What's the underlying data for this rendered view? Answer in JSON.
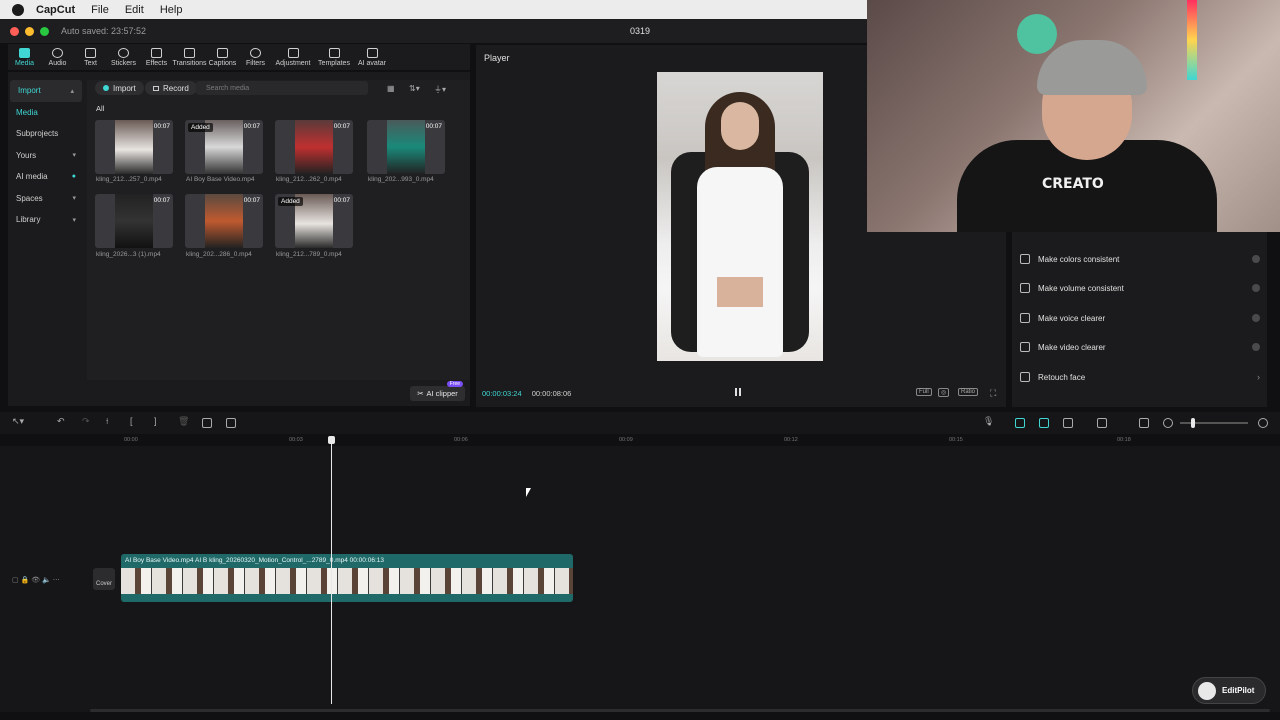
{
  "menubar": {
    "app": "CapCut",
    "items": [
      "File",
      "Edit",
      "Help"
    ]
  },
  "window": {
    "autosave": "Auto saved: 23:57:52",
    "project": "0319"
  },
  "toolbar": {
    "tools": [
      "Media",
      "Audio",
      "Text",
      "Stickers",
      "Effects",
      "Transitions",
      "Captions",
      "Filters",
      "Adjustment",
      "Templates",
      "AI avatar"
    ]
  },
  "sidebar": {
    "items": [
      {
        "label": "Import",
        "chev": "▴"
      },
      {
        "label": "Media",
        "chev": ""
      },
      {
        "label": "Subprojects",
        "chev": ""
      },
      {
        "label": "Yours",
        "chev": "▾"
      },
      {
        "label": "AI media",
        "chev": "●"
      },
      {
        "label": "Spaces",
        "chev": "▾"
      },
      {
        "label": "Library",
        "chev": "▾"
      }
    ]
  },
  "media": {
    "import_label": "Import",
    "record_label": "Record",
    "search_placeholder": "Search media",
    "filter_all": "All",
    "items": [
      {
        "name": "kling_212...257_0.mp4",
        "duration": "00:07",
        "added": ""
      },
      {
        "name": "AI Boy Base Video.mp4",
        "duration": "00:07",
        "added": "Added"
      },
      {
        "name": "kling_212...262_0.mp4",
        "duration": "00:07",
        "added": ""
      },
      {
        "name": "kling_202...993_0.mp4",
        "duration": "00:07",
        "added": ""
      },
      {
        "name": "kling_2026...3 (1).mp4",
        "duration": "00:07",
        "added": ""
      },
      {
        "name": "kling_202...286_0.mp4",
        "duration": "00:07",
        "added": ""
      },
      {
        "name": "kling_212...789_0.mp4",
        "duration": "00:07",
        "added": "Added"
      }
    ],
    "ai_clipper": "AI clipper",
    "ai_clipper_badge": "Free"
  },
  "player": {
    "label": "Player",
    "current_time": "00:00:03:24",
    "total_time": "00:00:08:06",
    "controls": [
      "Full",
      "Ratio"
    ]
  },
  "enhance": {
    "items": [
      {
        "label": "Make colors consistent",
        "icon": "palette-icon",
        "trail": "toggle"
      },
      {
        "label": "Make volume consistent",
        "icon": "sliders-icon",
        "trail": "toggle"
      },
      {
        "label": "Make voice clearer",
        "icon": "sparkle-icon",
        "trail": "toggle"
      },
      {
        "label": "Make video clearer",
        "icon": "hd-icon",
        "trail": "toggle"
      },
      {
        "label": "Retouch face",
        "icon": "face-icon",
        "trail": "arrow"
      }
    ]
  },
  "timeline": {
    "ruler": [
      "00:00",
      "00:03",
      "00:06",
      "00:09",
      "00:12",
      "00:15",
      "00:18"
    ],
    "cover_label": "Cover",
    "clip_label": "AI Boy Base Video.mp4   AI B   kling_20260320_Motion_Control_...2789_0.mp4   00:00:06:13"
  },
  "webcam": {
    "shirt_text": "CREATO"
  },
  "editpilot": {
    "label": "EditPilot"
  },
  "colors": {
    "accent": "#3fd6d3",
    "clip": "#1f6a68",
    "panel": "#1b1b1d"
  }
}
